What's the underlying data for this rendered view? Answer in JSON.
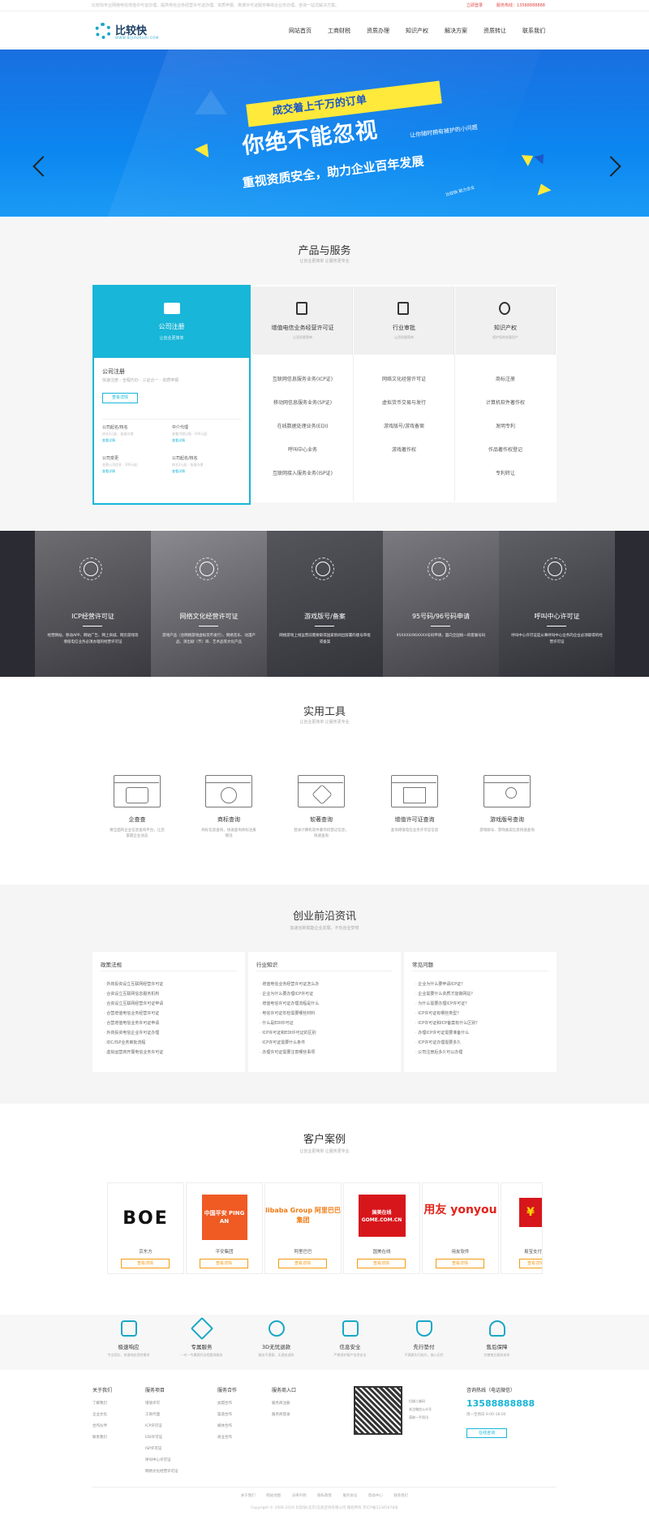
{
  "topbar": {
    "notice": "比较快专业网络电信增值许可证办理，提供电信业务经营许可证办理、资质申报、离港许可证服务等综合业务办理，咨询一站式解决方案。",
    "login": "立即登录",
    "hotline": "服务热线：13588888888"
  },
  "header": {
    "logo_text": "比较快",
    "logo_sub": "WWW.BIJIAOKUAI.COM",
    "nav": [
      "网站首页",
      "工商财税",
      "资质办理",
      "知识产权",
      "解决方案",
      "资质转让",
      "联系我们"
    ]
  },
  "banner": {
    "line1": "成交着上千万的订单",
    "line2": "你绝不能忽视",
    "line2_side": "让你随时拥有被护的小问题",
    "line3": "重视资质安全，助力企业百年发展",
    "tag": "比较快 助力企业"
  },
  "products": {
    "title": "产品与服务",
    "subtitle": "让创业更简单 让服务更专业",
    "featured": {
      "title": "公司注册",
      "subtitle": "让创业更简单",
      "name": "公司注册",
      "desc": "快速注册 · 全程代办 · 三证合一 · 资质申报",
      "button": "查看详情",
      "items": [
        {
          "name": "公司起名/核名",
          "small": "核名2元起 · 极速办理",
          "more": "查看详情"
        },
        {
          "name": "中介代理",
          "small": "查看代理记账 · 500元起",
          "more": "查看详情"
        },
        {
          "name": "公司变更",
          "small": "变更公司信息 · 300元起",
          "more": "查看详情"
        },
        {
          "name": "公司起名/核名",
          "small": "核名2元起 · 极速办理",
          "more": "查看详情"
        }
      ]
    },
    "columns": [
      {
        "title": "增值电信业务经营许可证",
        "subtitle": "让资质更简单",
        "items": [
          "互联网信息服务业务(ICP证)",
          "移动网信息服务业务(SP证)",
          "在线数据处理业务(EDI)",
          "呼叫中心业务",
          "互联网接入服务业务(ISP证)"
        ]
      },
      {
        "title": "行业审批",
        "subtitle": "让资质更简单",
        "items": [
          "网络文化经营许可证",
          "虚拟货币交易与发行",
          "游戏版号/游戏备案",
          "游戏著作权"
        ]
      },
      {
        "title": "知识产权",
        "subtitle": "保护您的创意资产",
        "items": [
          "商标注册",
          "计算机软件著作权",
          "发明专利",
          "作品著作权登记",
          "专利转让"
        ]
      }
    ]
  },
  "dark_tiles": [
    {
      "title": "ICP经营许可证",
      "desc": "经营网站、移动APP、网站广告、网上商城、网页游戏等增值电信业务必须办理的经营许可证"
    },
    {
      "title": "网络文化经营许可证",
      "desc": "游戏产品（含网络游戏虚拟货币发行）、网络音乐、动漫产品、演出剧（节）目、艺术品等文化产品"
    },
    {
      "title": "游戏版号/备案",
      "desc": "网络游戏上线运营前需要取得国家新闻出版署的版号审批或备案"
    },
    {
      "title": "95号码/96号码申请",
      "desc": "95XXXX/96XXXX号码申请，面向全国统一的客服号码"
    },
    {
      "title": "呼叫中心许可证",
      "desc": "呼叫中心许可证是从事呼叫中心业务的企业必须取得的经营许可证"
    }
  ],
  "tools": {
    "title": "实用工具",
    "subtitle": "让创业更简单 让服务更专业",
    "items": [
      {
        "name": "企查查",
        "desc": "要全面的企业信息查询平台，让您掌握企业动态"
      },
      {
        "name": "商标查询",
        "desc": "商标信息查询，快速查询商标注册情况"
      },
      {
        "name": "软著查询",
        "desc": "登录计算机软件著作权登记信息，快速查询"
      },
      {
        "name": "增值许可证查询",
        "desc": "查询增值电信业务许可证信息"
      },
      {
        "name": "游戏版号查询",
        "desc": "游戏版号、游戏备案信息快速查询"
      }
    ]
  },
  "news": {
    "title": "创业前沿资讯",
    "subtitle": "加速创新赋能企业发展，不负创业梦想",
    "cards": [
      {
        "title": "政策法规",
        "items": [
          "外商投资设立互联网经营许可证",
          "合资设立互联网信息服务机构",
          "合资设立互联网经营许可证申请",
          "合营增值电信业务经营许可证",
          "合营增值电信业务许可证申请",
          "外商投资电信企业许可证办理",
          "IDC/ISP业务审批流程",
          "虚拟运营商开展电信业务许可证"
        ]
      },
      {
        "title": "行业知识",
        "items": [
          "增值电信业务经营许可证怎么办",
          "企业为什么要办理ICP许可证",
          "增值电信许可证办理流程是什么",
          "电信许可证年检需要哪些材料",
          "什么是EDI许可证",
          "ICP许可证和EDI许可证的区别",
          "ICP许可证需要什么条件",
          "办理许可证需要注意哪些事项"
        ]
      },
      {
        "title": "常见问题",
        "items": [
          "企业为什么要申请ICP证？",
          "企业需要什么资质才能做网站？",
          "为什么需要办理ICP许可证？",
          "ICP许可证有哪些类型？",
          "ICP许可证和ICP备案有什么区别？",
          "办理ICP许可证需要准备什么",
          "ICP许可证办理需要多久",
          "公司注册后多久可以办理"
        ]
      }
    ]
  },
  "cases": {
    "title": "客户案例",
    "subtitle": "让创业更简单 让服务更专业",
    "items": [
      {
        "name": "京东方",
        "logo": "BOE",
        "button": "查看详情"
      },
      {
        "name": "平安集团",
        "logo": "中国平安 PING AN",
        "button": "查看详情"
      },
      {
        "name": "阿里巴巴",
        "logo": "libaba Group 阿里巴巴集团",
        "button": "查看详情"
      },
      {
        "name": "国美在线",
        "logo": "国美在线 GOME.COM.CN",
        "button": "查看详情"
      },
      {
        "name": "用友软件",
        "logo": "用友 yonyou",
        "button": "查看详情"
      },
      {
        "name": "易宝支付",
        "logo": "¥",
        "button": "查看详情"
      }
    ]
  },
  "features": [
    {
      "name": "极速响应",
      "desc": "专业团队，快速响应您的需求"
    },
    {
      "name": "专属服务",
      "desc": "一对一专属顾问全程跟进服务"
    },
    {
      "name": "3D无忧退款",
      "desc": "服务不满意，无理由退款"
    },
    {
      "name": "信息安全",
      "desc": "严格保护客户信息安全"
    },
    {
      "name": "先行垫付",
      "desc": "不满意先行赔付，放心无忧"
    },
    {
      "name": "售后保障",
      "desc": "完善售后服务体系"
    }
  ],
  "footer": {
    "columns": [
      {
        "title": "关于我们",
        "links": [
          "了解我们",
          "企业文化",
          "合作伙伴",
          "联系我们"
        ]
      },
      {
        "title": "服务项目",
        "links": [
          "增值许可",
          "工商代理",
          "ICP许可证",
          "EDI许可证",
          "ISP许可证",
          "呼叫中心许可证",
          "网络文化经营许可证"
        ]
      },
      {
        "title": "服务合作",
        "links": [
          "加盟合作",
          "渠道合作",
          "媒体合作",
          "商业合作"
        ]
      },
      {
        "title": "服务商入口",
        "links": [
          "服务商注册",
          "服务商登录"
        ]
      }
    ],
    "qr_text": [
      "扫描二维码",
      "关注微信公众号",
      "获取一手资讯"
    ],
    "hotline_title": "咨询热线（电话微信）",
    "hotline": "13588888888",
    "hotline_sub": "周一至周日 9:00-18:00",
    "consult": "在线咨询",
    "links": [
      "关于我们",
      "网站地图",
      "法律声明",
      "隐私政策",
      "服务协议",
      "帮助中心",
      "联系我们"
    ],
    "copyright": "Copyright © 2006-2024 比较快(北京)信息咨询有限公司 版权所有 京ICP备12345678号"
  }
}
